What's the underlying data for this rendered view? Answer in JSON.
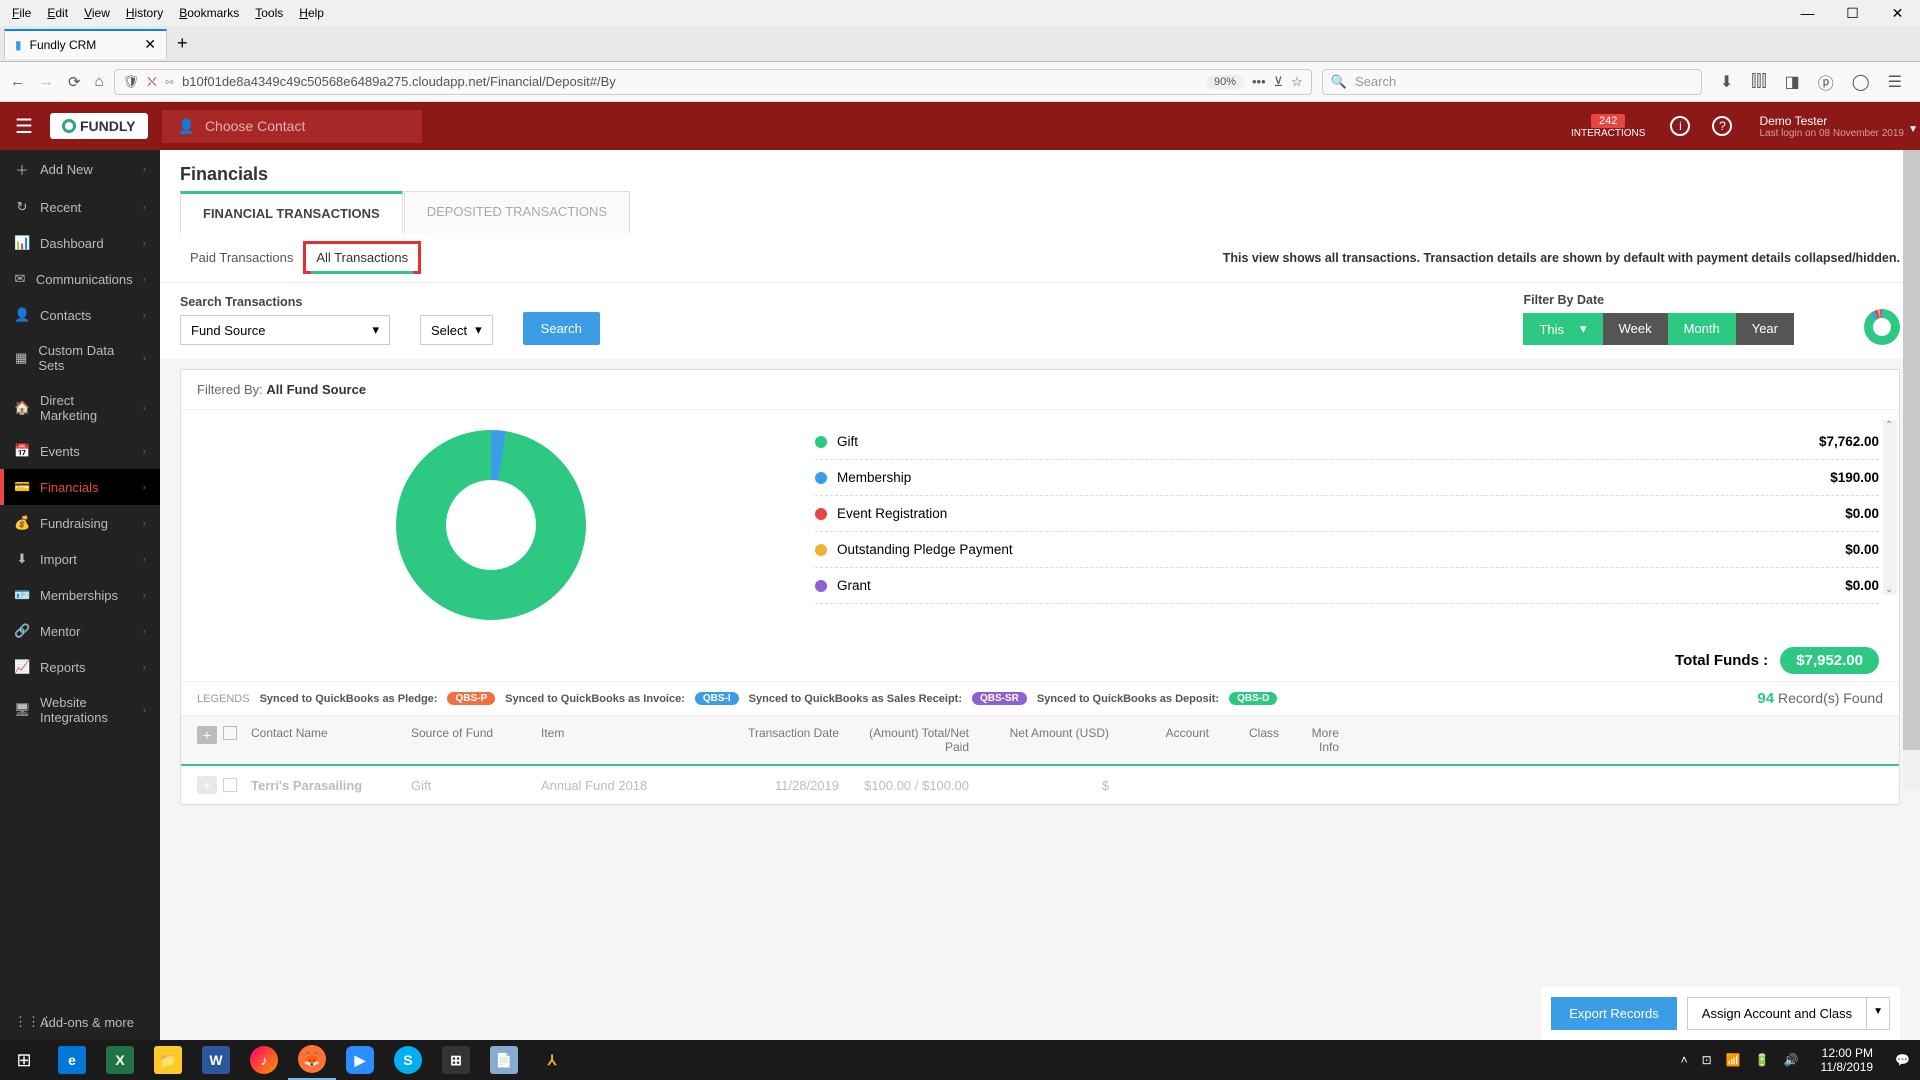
{
  "browser": {
    "menus": [
      "File",
      "Edit",
      "View",
      "History",
      "Bookmarks",
      "Tools",
      "Help"
    ],
    "tab_title": "Fundly CRM",
    "url_display": "b10f01de8a4349c49c50568e6489a275.cloudapp.net/Financial/Deposit#/By",
    "zoom": "90%",
    "search_placeholder": "Search"
  },
  "header": {
    "logo_text": "FUNDLY",
    "contact_placeholder": "Choose Contact",
    "interactions_count": "242",
    "interactions_label": "INTERACTIONS",
    "user_name": "Demo Tester",
    "last_login": "Last login on 08 November 2019"
  },
  "sidebar": {
    "items": [
      {
        "icon": "＋",
        "label": "Add New"
      },
      {
        "icon": "↻",
        "label": "Recent"
      },
      {
        "icon": "📊",
        "label": "Dashboard"
      },
      {
        "icon": "✉",
        "label": "Communications"
      },
      {
        "icon": "👤",
        "label": "Contacts"
      },
      {
        "icon": "▦",
        "label": "Custom Data Sets"
      },
      {
        "icon": "🏠",
        "label": "Direct Marketing"
      },
      {
        "icon": "📅",
        "label": "Events"
      },
      {
        "icon": "💳",
        "label": "Financials"
      },
      {
        "icon": "💰",
        "label": "Fundraising"
      },
      {
        "icon": "⬇",
        "label": "Import"
      },
      {
        "icon": "🪪",
        "label": "Memberships"
      },
      {
        "icon": "🔗",
        "label": "Mentor"
      },
      {
        "icon": "📈",
        "label": "Reports"
      },
      {
        "icon": "🖥",
        "label": "Website Integrations"
      }
    ],
    "active_index": 8,
    "footer": {
      "icon": "⋮⋮⋮",
      "label": "Add-ons & more"
    }
  },
  "page": {
    "title": "Financials",
    "main_tabs": [
      "FINANCIAL TRANSACTIONS",
      "DEPOSITED TRANSACTIONS"
    ],
    "main_tab_active": 0,
    "sub_tabs": [
      "Paid Transactions",
      "All Transactions"
    ],
    "sub_tab_active": 1,
    "view_description": "This view shows all transactions. Transaction details are shown by default with payment details collapsed/hidden.",
    "search_label": "Search Transactions",
    "fund_source_selected": "Fund Source",
    "select_label": "Select",
    "search_button": "Search",
    "filter_date_label": "Filter By Date",
    "date_segments": {
      "this": "This",
      "week": "Week",
      "month": "Month",
      "year": "Year"
    },
    "filtered_by_prefix": "Filtered By:",
    "filtered_by_value": "All Fund Source",
    "legend": [
      {
        "color": "#2dc983",
        "label": "Gift",
        "value": "$7,762.00"
      },
      {
        "color": "#3b9de8",
        "label": "Membership",
        "value": "$190.00"
      },
      {
        "color": "#e84545",
        "label": "Event Registration",
        "value": "$0.00"
      },
      {
        "color": "#f0b030",
        "label": "Outstanding Pledge Payment",
        "value": "$0.00"
      },
      {
        "color": "#9060d0",
        "label": "Grant",
        "value": "$0.00"
      }
    ],
    "total_label": "Total Funds :",
    "total_value": "$7,952.00",
    "qb_legends_label": "LEGENDS",
    "qb_legends": [
      {
        "text": "Synced to QuickBooks as Pledge:",
        "badge": "QBS-P",
        "color": "#f07040"
      },
      {
        "text": "Synced to QuickBooks as Invoice:",
        "badge": "QBS-I",
        "color": "#3b9de8"
      },
      {
        "text": "Synced to QuickBooks as Sales Receipt:",
        "badge": "QBS-SR",
        "color": "#9060d0"
      },
      {
        "text": "Synced to QuickBooks as Deposit:",
        "badge": "QBS-D",
        "color": "#2dc983"
      }
    ],
    "records_count": "94",
    "records_label": "Record(s) Found",
    "columns": [
      "Contact Name",
      "Source of Fund",
      "Item",
      "Transaction Date",
      "(Amount) Total/Net Paid",
      "Net Amount (USD)",
      "Account",
      "Class",
      "More Info"
    ],
    "sample_row": {
      "contact": "Terri's Parasailing",
      "source": "Gift",
      "item": "Annual Fund 2018",
      "date": "11/28/2019",
      "amount": "$100.00 / $100.00",
      "net": "$"
    },
    "export_button": "Export Records",
    "assign_button": "Assign Account and Class"
  },
  "taskbar": {
    "time": "12:00 PM",
    "date": "11/8/2019"
  },
  "chart_data": {
    "type": "pie",
    "title": "All Fund Source",
    "series": [
      {
        "name": "Gift",
        "value": 7762.0,
        "color": "#2dc983"
      },
      {
        "name": "Membership",
        "value": 190.0,
        "color": "#3b9de8"
      },
      {
        "name": "Event Registration",
        "value": 0.0,
        "color": "#e84545"
      },
      {
        "name": "Outstanding Pledge Payment",
        "value": 0.0,
        "color": "#f0b030"
      },
      {
        "name": "Grant",
        "value": 0.0,
        "color": "#9060d0"
      }
    ],
    "total": 7952.0
  }
}
